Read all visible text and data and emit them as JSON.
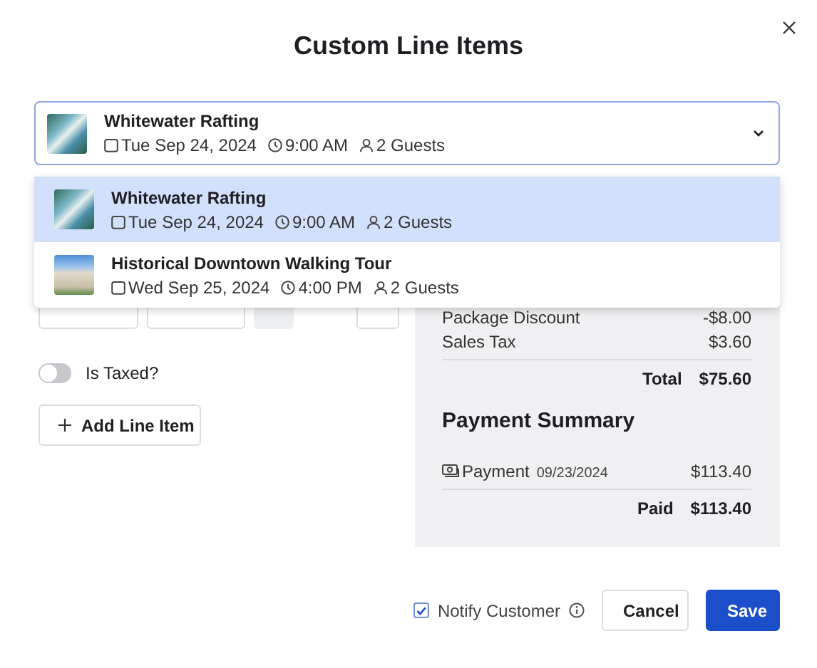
{
  "dialog": {
    "title": "Custom Line Items"
  },
  "selected_tour": {
    "name": "Whitewater Rafting",
    "date": "Tue Sep 24, 2024",
    "time": "9:00 AM",
    "guests": "2 Guests",
    "kind": "river"
  },
  "dropdown": {
    "expanded": true,
    "options": [
      {
        "name": "Whitewater Rafting",
        "date": "Tue Sep 24, 2024",
        "time": "9:00 AM",
        "guests": "2 Guests",
        "kind": "river",
        "selected": true
      },
      {
        "name": "Historical Downtown Walking Tour",
        "date": "Wed Sep 25, 2024",
        "time": "4:00 PM",
        "guests": "2 Guests",
        "kind": "building",
        "selected": false
      }
    ]
  },
  "is_taxed": {
    "label": "Is Taxed?",
    "on": false
  },
  "add_button": {
    "label": "Add Line Item"
  },
  "summary": {
    "lines": [
      {
        "label": "Package Discount",
        "amount": "-$8.00"
      },
      {
        "label": "Sales Tax",
        "amount": "$3.60"
      }
    ],
    "total": {
      "label": "Total",
      "amount": "$75.60"
    }
  },
  "payment_summary": {
    "title": "Payment Summary",
    "payments": [
      {
        "label": "Payment",
        "date": "09/23/2024",
        "amount": "$113.40"
      }
    ],
    "paid": {
      "label": "Paid",
      "amount": "$113.40"
    }
  },
  "footer": {
    "notify": {
      "label": "Notify Customer",
      "checked": true
    },
    "buttons": [
      {
        "label": "Cancel",
        "kind": "secondary"
      },
      {
        "label": "Save",
        "kind": "primary"
      }
    ]
  }
}
